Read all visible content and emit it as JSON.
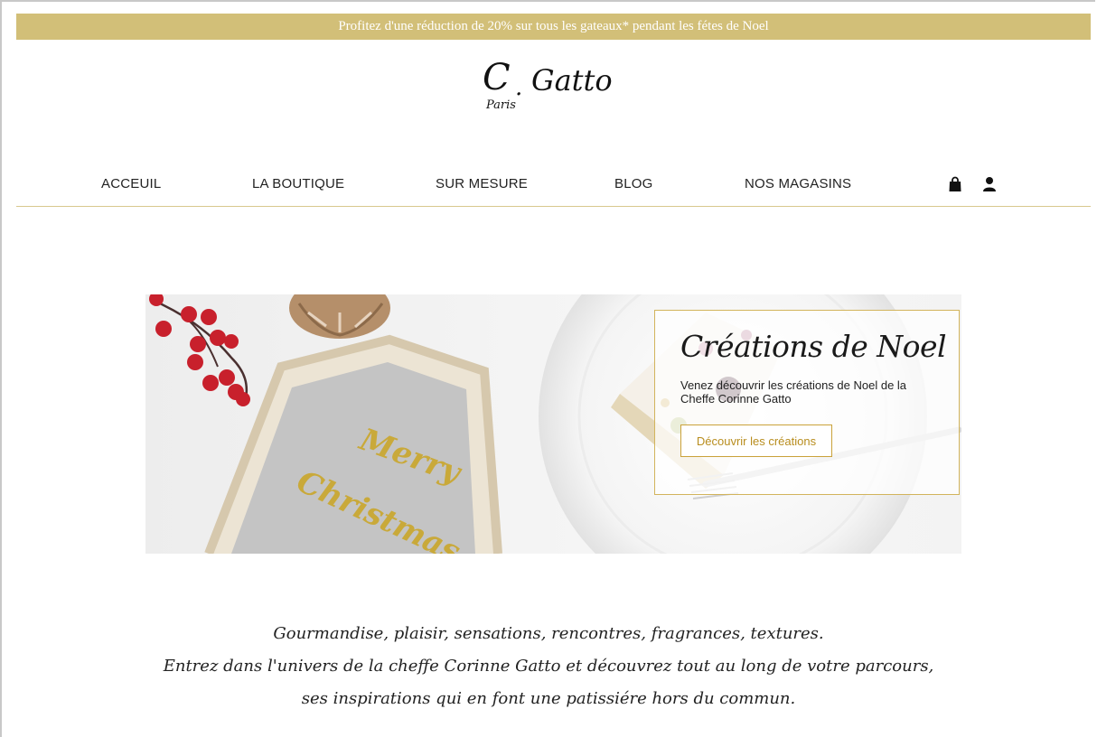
{
  "promo_banner": {
    "text": "Profitez d'une réduction de 20% sur tous les gateaux* pendant les fétes de Noel"
  },
  "logo": {
    "c": "C",
    "dot": ".",
    "gatto": "Gatto",
    "paris": "Paris"
  },
  "nav": {
    "items": [
      {
        "label": "ACCEUIL"
      },
      {
        "label": "LA BOUTIQUE"
      },
      {
        "label": "SUR MESURE"
      },
      {
        "label": "BLOG"
      },
      {
        "label": "NOS MAGASINS"
      }
    ],
    "icons": [
      "shopping-bag-icon",
      "user-icon"
    ]
  },
  "hero": {
    "title": "Créations de Noel",
    "text": "Venez découvrir les créations de Noel de la Cheffe Corinne Gatto",
    "button_label": "Découvrir les créations",
    "sign_line1": "Merry",
    "sign_line2": "Christmas"
  },
  "tagline": {
    "line1": "Gourmandise, plaisir, sensations, rencontres, fragrances, textures.",
    "line2": "Entrez dans l'univers de la cheffe Corinne Gatto et découvrez tout au long de votre parcours,",
    "line3": "ses inspirations qui en font une patissiére hors du commun."
  },
  "colors": {
    "gold": "#d2bf78",
    "accent_text": "#b88d1e",
    "berry_red": "#c8202c"
  }
}
